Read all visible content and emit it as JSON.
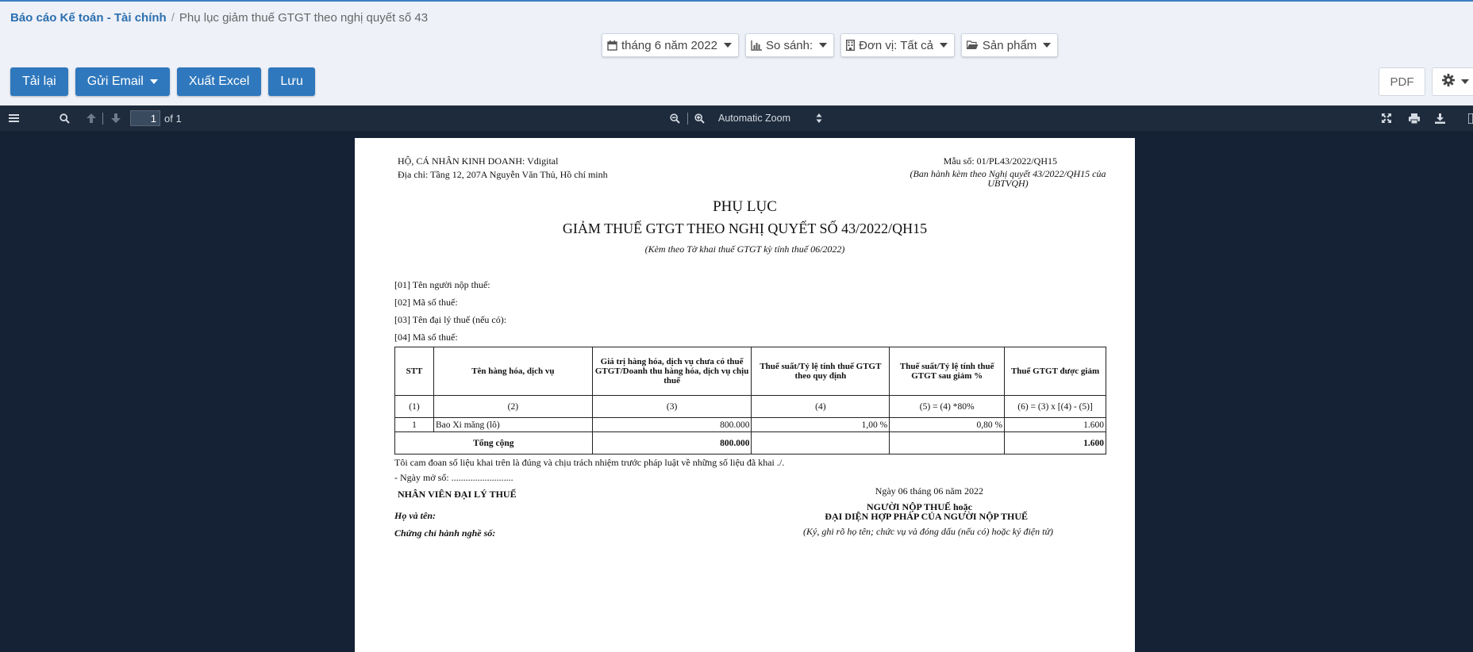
{
  "breadcrumb": {
    "parent": "Báo cáo Kế toán - Tài chính",
    "separator": "/",
    "current": "Phụ lục giảm thuế GTGT theo nghị quyết số 43"
  },
  "filters": {
    "period": "tháng 6 năm 2022",
    "compare": "So sánh:",
    "unit": "Đơn vị: Tất cả",
    "product": "Sản phẩm"
  },
  "toolbar": {
    "reload": "Tải lại",
    "send_email": "Gửi Email",
    "export_excel": "Xuất Excel",
    "save": "Lưu",
    "pdf": "PDF"
  },
  "viewer": {
    "page_number": "1",
    "page_total": "of 1",
    "zoom": "Automatic Zoom"
  },
  "document": {
    "org": "HỘ, CÁ NHÂN KINH DOANH: Vdigital",
    "address": "Địa chỉ: Tầng 12, 207A Nguyễn Văn Thủ, Hồ chí minh",
    "form_no": "Mẫu số: 01/PL43/2022/QH15",
    "form_note": "(Ban hành kèm theo Nghị quyết 43/2022/QH15 của UBTVQH)",
    "title": "PHỤ LỤC",
    "subtitle": "GIẢM THUẾ GTGT THEO NGHỊ QUYẾT SỐ 43/2022/QH15",
    "title_note": "(Kèm theo Tờ khai thuế GTGT kỳ tính thuế 06/2022)",
    "fields": [
      "[01] Tên người nộp thuế:",
      "[02] Mã số thuế:",
      "[03] Tên đại lý thuế (nếu có):",
      "[04] Mã số thuế:"
    ],
    "table": {
      "headers": [
        "STT",
        "Tên hàng hóa, dịch vụ",
        "Giá trị hàng hóa, dịch vụ chưa có thuế GTGT/Doanh thu hàng hóa, dịch vụ chịu thuế",
        "Thuế suất/Tỷ lệ tính thuế GTGT theo quy định",
        "Thuế suất/Tỷ lệ tính thuế GTGT sau giảm %",
        "Thuế GTGT được giảm"
      ],
      "col_numbers": [
        "(1)",
        "(2)",
        "(3)",
        "(4)",
        "(5) = (4) *80%",
        "(6) = (3) x [(4) - (5)]"
      ],
      "rows": [
        [
          "1",
          "Bao Xi măng (lô)",
          "800.000",
          "1,00 %",
          "0,80 %",
          "1.600"
        ]
      ],
      "total": {
        "label": "Tổng cộng",
        "value": "800.000",
        "reduced": "1.600"
      }
    },
    "commitment": "Tôi cam đoan số liệu khai trên là đúng và chịu trách nhiệm trước pháp luật về những số liệu đã khai ./.",
    "open_date": "- Ngày mở sổ: ..........................",
    "sign_date": "Ngày 06 tháng 06 năm 2022",
    "agent_title": "NHÂN VIÊN ĐẠI LÝ THUẾ",
    "taxpayer_line1": "NGƯỜI NỘP THUẾ hoặc",
    "taxpayer_line2": "ĐẠI DIỆN HỢP PHÁP CỦA NGƯỜI NỘP THUẾ",
    "full_name": "Họ và tên:",
    "certificate": "Chứng chỉ hành nghề số:",
    "sign_note": "(Ký, ghi rõ họ tên; chức vụ và đóng dấu (nếu có) hoặc ký điện tử)"
  }
}
